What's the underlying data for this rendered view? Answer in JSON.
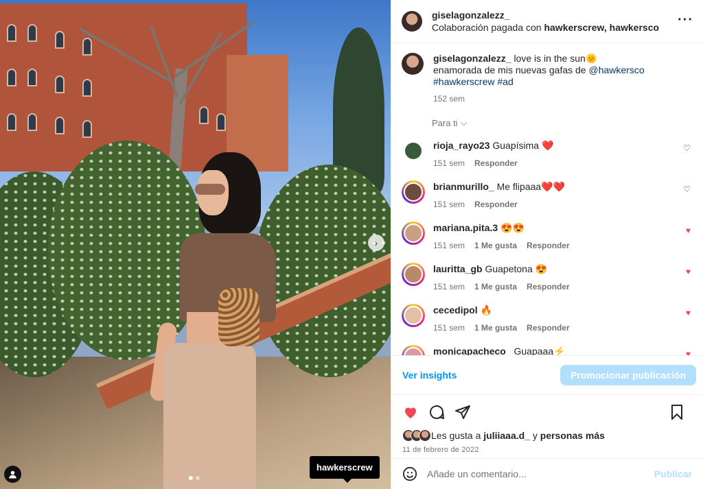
{
  "post": {
    "username": "giselagonzalezz_",
    "subtitle_prefix": "Colaboración pagada con",
    "partners": "hawkerscrew, hawkersco",
    "more_icon": "more-horizontal-icon",
    "tag_label": "hawkerscrew"
  },
  "caption": {
    "username": "giselagonzalezz_",
    "line1": "love is in the sun🌞",
    "line2_text": "enamorada de mis nuevas gafas de",
    "line2_mention": "@hawkersco",
    "hashtag1": "#hawkerscrew",
    "hashtag2": "#ad",
    "time": "152 sem"
  },
  "filter": {
    "label": "Para ti",
    "icon": "chevron-down-icon"
  },
  "comments": [
    {
      "user": "rioja_rayo23",
      "text": "Guapísima ❤️",
      "time": "151 sem",
      "likes": "",
      "reply": "Responder",
      "liked": false,
      "avatar_color": "#3a5a3a",
      "ring": false
    },
    {
      "user": "brianmurillo_",
      "text": "Me flipaaa❤️❤️",
      "time": "151 sem",
      "likes": "",
      "reply": "Responder",
      "liked": false,
      "avatar_color": "#6d4c3d",
      "ring": true
    },
    {
      "user": "mariana.pita.3",
      "text": "😍😍",
      "time": "151 sem",
      "likes": "1 Me gusta",
      "reply": "Responder",
      "liked": true,
      "avatar_color": "#c9a084",
      "ring": true
    },
    {
      "user": "lauritta_gb",
      "text": "Guapetona 😍",
      "time": "151 sem",
      "likes": "1 Me gusta",
      "reply": "Responder",
      "liked": true,
      "avatar_color": "#b88a6b",
      "ring": true
    },
    {
      "user": "cecedipol",
      "text": "🔥",
      "time": "151 sem",
      "likes": "1 Me gusta",
      "reply": "Responder",
      "liked": true,
      "avatar_color": "#e3c0a3",
      "ring": true
    },
    {
      "user": "monicapacheco_",
      "text": "Guapaaa⚡️",
      "time": "",
      "likes": "",
      "reply": "",
      "liked": true,
      "avatar_color": "#d89aa0",
      "ring": true
    }
  ],
  "insights": {
    "link": "Ver insights",
    "promote": "Promocionar publicación"
  },
  "likes": {
    "prefix": "Les gusta a",
    "user": "juliiaaa.d_",
    "mid": "y",
    "rest": "personas más"
  },
  "date": "11 de febrero de 2022",
  "add_comment": {
    "placeholder": "Añade un comentario...",
    "publish": "Publicar"
  },
  "colors": {
    "accent": "#0095f6",
    "like": "#ed4956",
    "muted": "#737373"
  }
}
